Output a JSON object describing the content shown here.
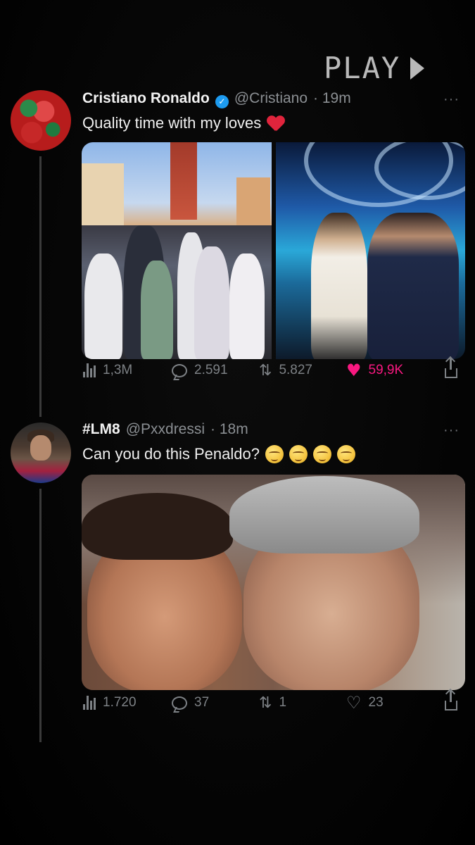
{
  "overlay": {
    "play_label": "PLAY"
  },
  "tweets": [
    {
      "author_name": "Cristiano Ronaldo",
      "handle": "@Cristiano",
      "time": "· 19m",
      "verified": true,
      "text": "Quality time with my loves",
      "more": "···",
      "stats": {
        "views": "1,3M",
        "replies": "2.591",
        "retweets": "5.827",
        "likes": "59,9K",
        "liked": true
      }
    },
    {
      "author_name": "#LM8",
      "handle": "@Pxxdressi",
      "time": "· 18m",
      "verified": false,
      "text": "Can you do this Penaldo?",
      "more": "···",
      "stats": {
        "views": "1.720",
        "replies": "37",
        "retweets": "1",
        "likes": "23",
        "liked": false
      }
    }
  ],
  "colors": {
    "background": "#000000",
    "liked": "#f91880",
    "verified": "#1d9bf0",
    "muted_text": "#8b8f93"
  },
  "icons": {
    "views": "bar-chart-icon",
    "replies": "reply-bubble-icon",
    "retweets": "retweet-icon",
    "likes": "heart-icon",
    "share": "share-icon"
  }
}
